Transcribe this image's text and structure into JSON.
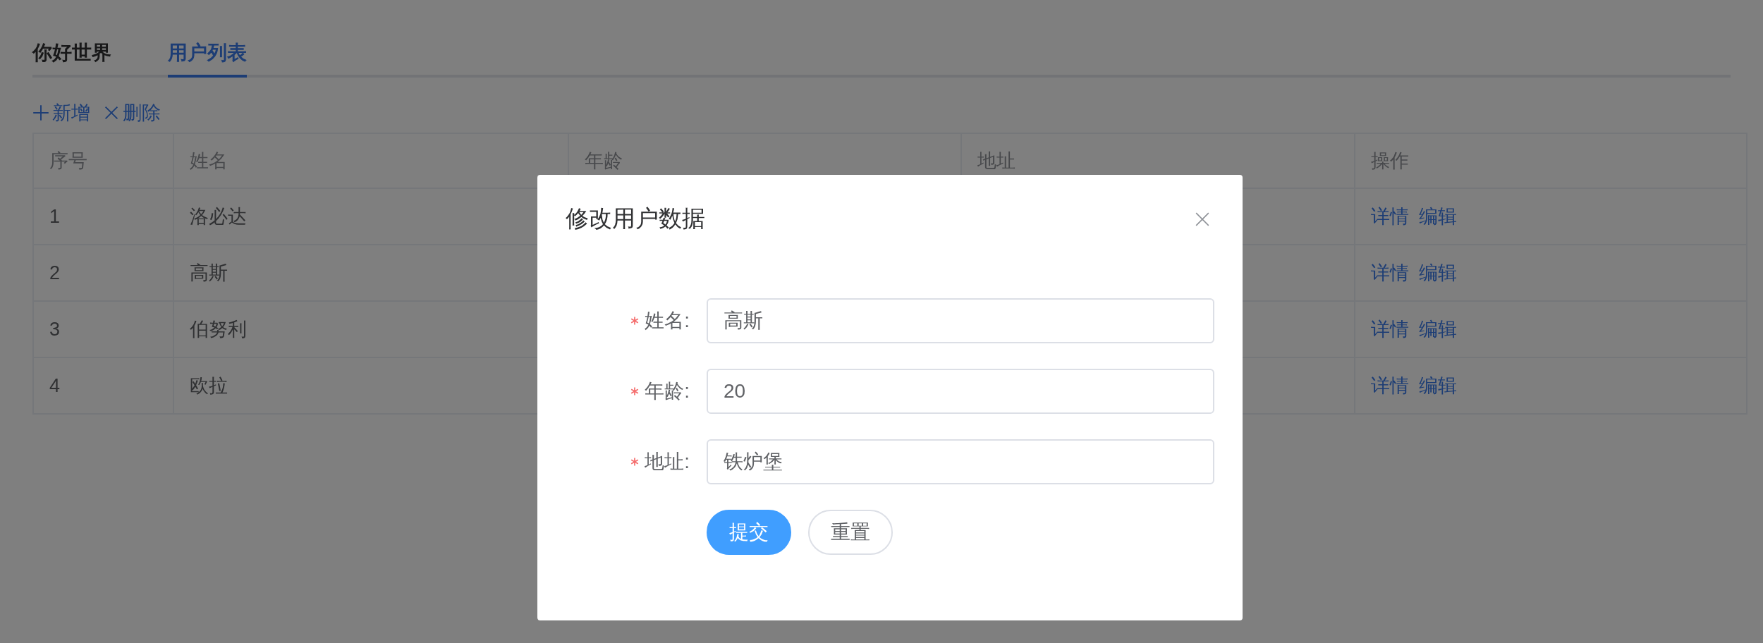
{
  "tabs": [
    {
      "label": "你好世界",
      "selected": false
    },
    {
      "label": "用户列表",
      "selected": true
    }
  ],
  "toolbar": [
    {
      "kind": "add",
      "label": "新增"
    },
    {
      "kind": "delete",
      "label": "删除"
    }
  ],
  "table": {
    "columns": [
      "序号",
      "姓名",
      "年龄",
      "地址",
      "操作"
    ],
    "rows": [
      {
        "index": "1",
        "name": "洛必达",
        "actions": [
          "详情",
          "编辑"
        ]
      },
      {
        "index": "2",
        "name": "高斯",
        "actions": [
          "详情",
          "编辑"
        ]
      },
      {
        "index": "3",
        "name": "伯努利",
        "actions": [
          "详情",
          "编辑"
        ]
      },
      {
        "index": "4",
        "name": "欧拉",
        "actions": [
          "详情",
          "编辑"
        ]
      }
    ]
  },
  "dialog": {
    "title": "修改用户数据",
    "fields": [
      {
        "label": "姓名:",
        "required": true,
        "value": "高斯"
      },
      {
        "label": "年龄:",
        "required": true,
        "value": "20"
      },
      {
        "label": "地址:",
        "required": true,
        "value": "铁炉堡"
      }
    ],
    "buttons": [
      {
        "kind": "primary",
        "label": "提交"
      },
      {
        "kind": "default",
        "label": "重置"
      }
    ]
  }
}
